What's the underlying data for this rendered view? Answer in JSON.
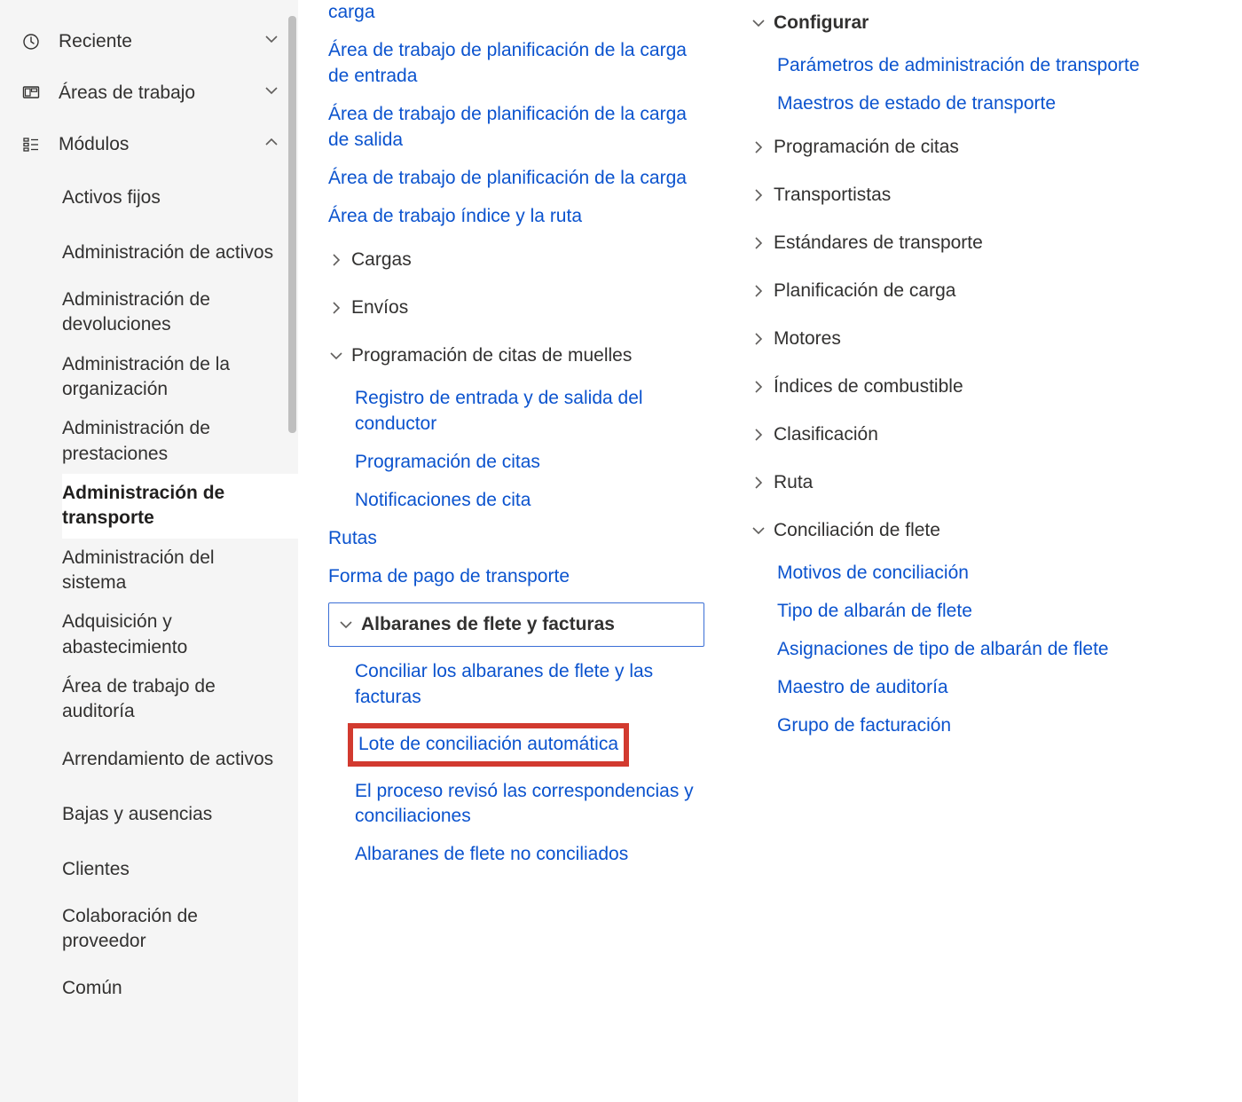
{
  "sidebar": {
    "recent": "Reciente",
    "workspaces": "Áreas de trabajo",
    "modules": "Módulos",
    "items": [
      "Activos fijos",
      "Administración de activos",
      "Administración de devoluciones",
      "Administración de la organización",
      "Administración de prestaciones",
      "Administración de transporte",
      "Administración del sistema",
      "Adquisición y abastecimiento",
      "Área de trabajo de auditoría",
      "Arrendamiento de activos",
      "Bajas y ausencias",
      "Clientes",
      "Colaboración de proveedor",
      "Común"
    ],
    "active_index": 5
  },
  "col1": {
    "links_top": [
      "carga",
      "Área de trabajo de planificación de la carga de entrada",
      "Área de trabajo de planificación de la carga de salida",
      "Área de trabajo de planificación de la carga",
      "Área de trabajo índice y la ruta"
    ],
    "groups_collapsed": [
      "Cargas",
      "Envíos"
    ],
    "dock_group": "Programación de citas de muelles",
    "dock_children": [
      "Registro de entrada y de salida del conductor",
      "Programación de citas",
      "Notificaciones de cita"
    ],
    "links_mid": [
      "Rutas",
      "Forma de pago de transporte"
    ],
    "freight_group": "Albaranes de flete y facturas",
    "freight_children": [
      "Conciliar los albaranes de flete y las facturas",
      "Lote de conciliación automática",
      "El proceso revisó las correspondencias y conciliaciones",
      "Albaranes de flete no conciliados"
    ]
  },
  "col2": {
    "config_group": "Configurar",
    "config_links": [
      "Parámetros de administración de transporte",
      "Maestros de estado de transporte"
    ],
    "collapsed": [
      "Programación de citas",
      "Transportistas",
      "Estándares de transporte",
      "Planificación de carga",
      "Motores",
      "Índices de combustible",
      "Clasificación",
      "Ruta"
    ],
    "recon_group": "Conciliación de flete",
    "recon_children": [
      "Motivos de conciliación",
      "Tipo de albarán de flete",
      "Asignaciones de tipo de albarán de flete",
      "Maestro de auditoría",
      "Grupo de facturación"
    ]
  }
}
